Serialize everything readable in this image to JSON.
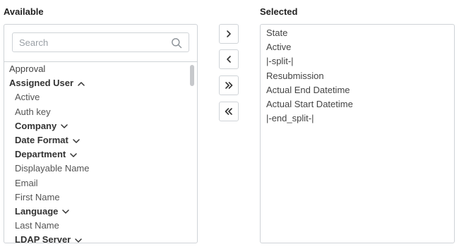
{
  "labels": {
    "available": "Available",
    "selected": "Selected"
  },
  "search": {
    "placeholder": "Search",
    "value": ""
  },
  "available_items": [
    {
      "label": "Approval",
      "level": 0,
      "bold": false
    },
    {
      "label": "Assigned User",
      "level": 0,
      "bold": true,
      "expanded": true
    },
    {
      "label": "Active",
      "level": 1,
      "bold": false
    },
    {
      "label": "Auth key",
      "level": 1,
      "bold": false
    },
    {
      "label": "Company",
      "level": 1,
      "bold": true,
      "expanded": false
    },
    {
      "label": "Date Format",
      "level": 1,
      "bold": true,
      "expanded": false
    },
    {
      "label": "Department",
      "level": 1,
      "bold": true,
      "expanded": false
    },
    {
      "label": "Displayable Name",
      "level": 1,
      "bold": false
    },
    {
      "label": "Email",
      "level": 1,
      "bold": false
    },
    {
      "label": "First Name",
      "level": 1,
      "bold": false
    },
    {
      "label": "Language",
      "level": 1,
      "bold": true,
      "expanded": false
    },
    {
      "label": "Last Name",
      "level": 1,
      "bold": false
    },
    {
      "label": "LDAP Server",
      "level": 1,
      "bold": true,
      "expanded": false
    }
  ],
  "selected_items": [
    "State",
    "Active",
    "|-split-|",
    "Resubmission",
    "Actual End Datetime",
    "Actual Start Datetime",
    "|-end_split-|"
  ],
  "buttons": {
    "move_right_icon": "chevron-right-icon",
    "move_left_icon": "chevron-left-icon",
    "move_all_right_icon": "double-chevron-right-icon",
    "move_all_left_icon": "double-chevron-left-icon"
  },
  "colors": {
    "border": "#cfd3d7",
    "scroll_thumb": "#c6c8cb",
    "text": "#444444"
  }
}
